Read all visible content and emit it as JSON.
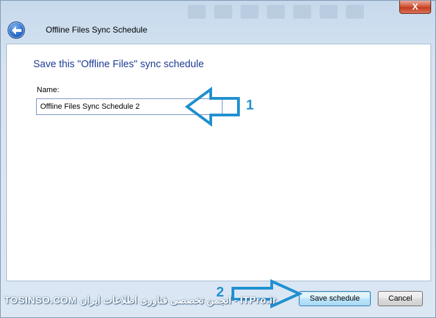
{
  "window": {
    "title": "Offline Files Sync Schedule",
    "close_glyph": "X"
  },
  "page": {
    "heading": "Save this \"Offline Files\" sync schedule",
    "name_label": "Name:",
    "name_value": "Offline Files Sync Schedule 2"
  },
  "footer": {
    "save_label": "Save schedule",
    "cancel_label": "Cancel"
  },
  "annotations": {
    "step1": "1",
    "step2": "2"
  },
  "watermark": {
    "text": "TOSINSO.COM انجمن تخصصی فناوری اطلاعات ایران - ITPro.ir"
  },
  "icons": {
    "back": "back-arrow-icon",
    "close": "close-icon",
    "annotation_arrow": "arrow-icon"
  },
  "colors": {
    "heading": "#1e3b93",
    "annotation": "#2090d0",
    "close": "#c43b1e"
  }
}
